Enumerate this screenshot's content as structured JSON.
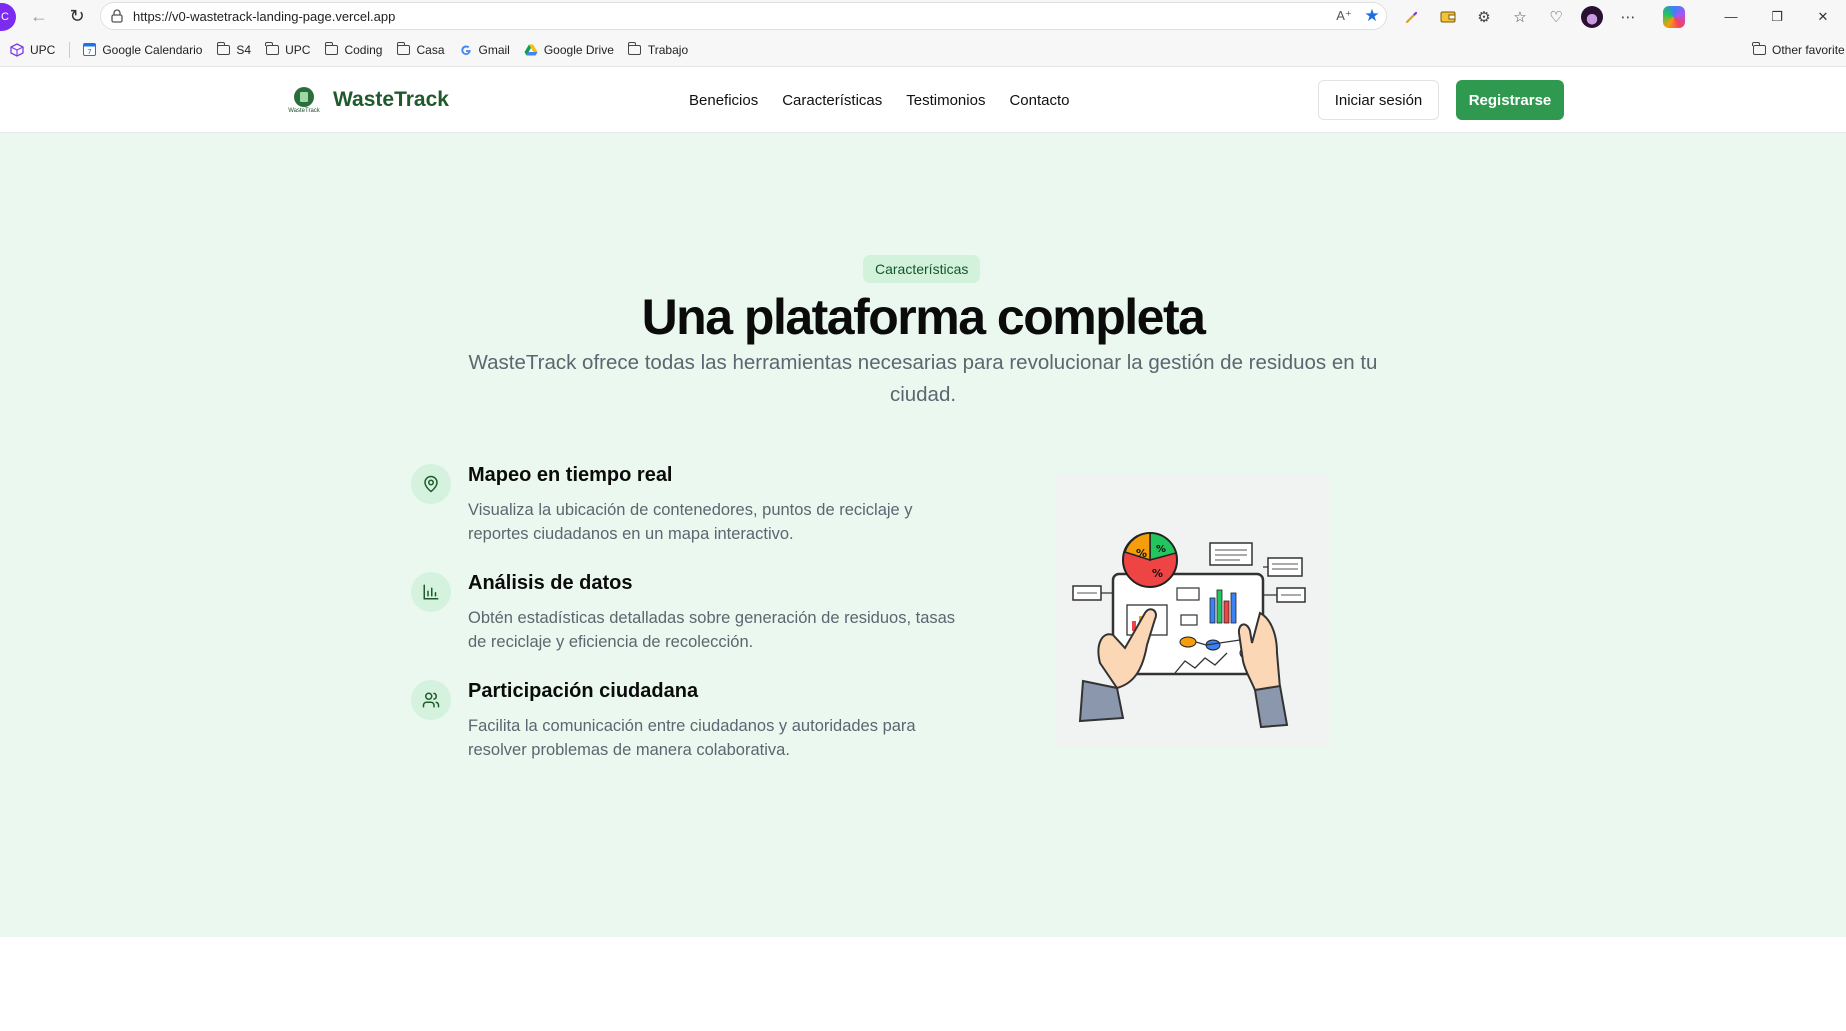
{
  "browser": {
    "profile_initial": "C",
    "url": "https://v0-wastetrack-landing-page.vercel.app",
    "bookmarks": [
      {
        "label": "UPC",
        "icon": "cube-icon"
      },
      {
        "label": "Google Calendario",
        "icon": "calendar-icon"
      },
      {
        "label": "S4",
        "icon": "folder-icon"
      },
      {
        "label": "UPC",
        "icon": "folder-icon"
      },
      {
        "label": "Coding",
        "icon": "folder-icon"
      },
      {
        "label": "Casa",
        "icon": "folder-icon"
      },
      {
        "label": "Gmail",
        "icon": "google-icon"
      },
      {
        "label": "Google Drive",
        "icon": "drive-icon"
      },
      {
        "label": "Trabajo",
        "icon": "folder-icon"
      }
    ],
    "other_favorites": "Other favorite"
  },
  "header": {
    "logo_text": "WasteTrack",
    "logo_small": "WasteTrack",
    "nav": [
      "Beneficios",
      "Características",
      "Testimonios",
      "Contacto"
    ],
    "login": "Iniciar sesión",
    "register": "Registrarse"
  },
  "features": {
    "pill": "Características",
    "title": "Una plataforma completa",
    "subtitle": "WasteTrack ofrece todas las herramientas necesarias para revolucionar la gestión de residuos en tu ciudad.",
    "items": [
      {
        "title": "Mapeo en tiempo real",
        "desc": "Visualiza la ubicación de contenedores, puntos de reciclaje y reportes ciudadanos en un mapa interactivo.",
        "icon": "map-pin-icon"
      },
      {
        "title": "Análisis de datos",
        "desc": "Obtén estadísticas detalladas sobre generación de residuos, tasas de reciclaje y eficiencia de recolección.",
        "icon": "bar-chart-icon"
      },
      {
        "title": "Participación ciudadana",
        "desc": "Facilita la comunicación entre ciudadanos y autoridades para resolver problemas de manera colaborativa.",
        "icon": "users-icon"
      }
    ],
    "illustration_pie_label": "%"
  },
  "colors": {
    "brand_green": "#2f9a4f",
    "section_bg": "#eaf8ef",
    "pill_bg": "#d2f2dc"
  }
}
